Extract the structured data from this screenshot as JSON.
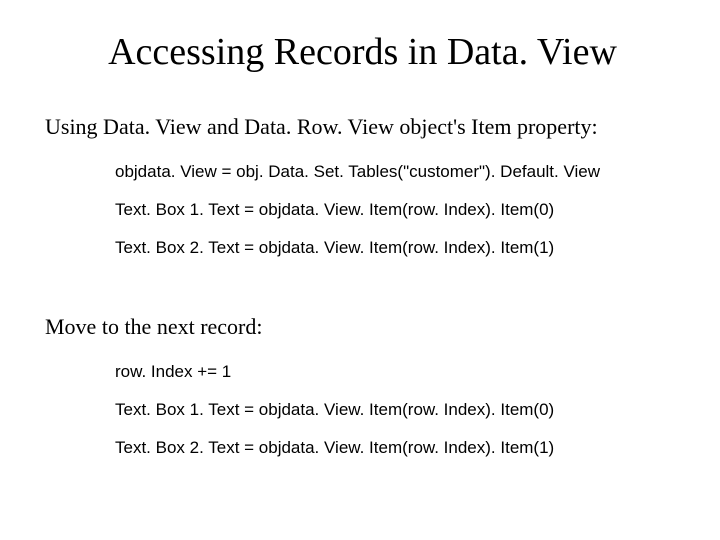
{
  "title": "Accessing Records in Data. View",
  "section1": {
    "heading": "Using Data. View and Data. Row. View object's Item property:",
    "lines": [
      "objdata. View = obj. Data. Set. Tables(\"customer\"). Default. View",
      "Text. Box 1. Text = objdata. View. Item(row. Index). Item(0)",
      "Text. Box 2. Text = objdata. View. Item(row. Index). Item(1)"
    ]
  },
  "section2": {
    "heading": "Move to the next record:",
    "lines": [
      "row. Index += 1",
      "Text. Box 1. Text = objdata. View. Item(row. Index). Item(0)",
      "Text. Box 2. Text = objdata. View. Item(row. Index). Item(1)"
    ]
  }
}
